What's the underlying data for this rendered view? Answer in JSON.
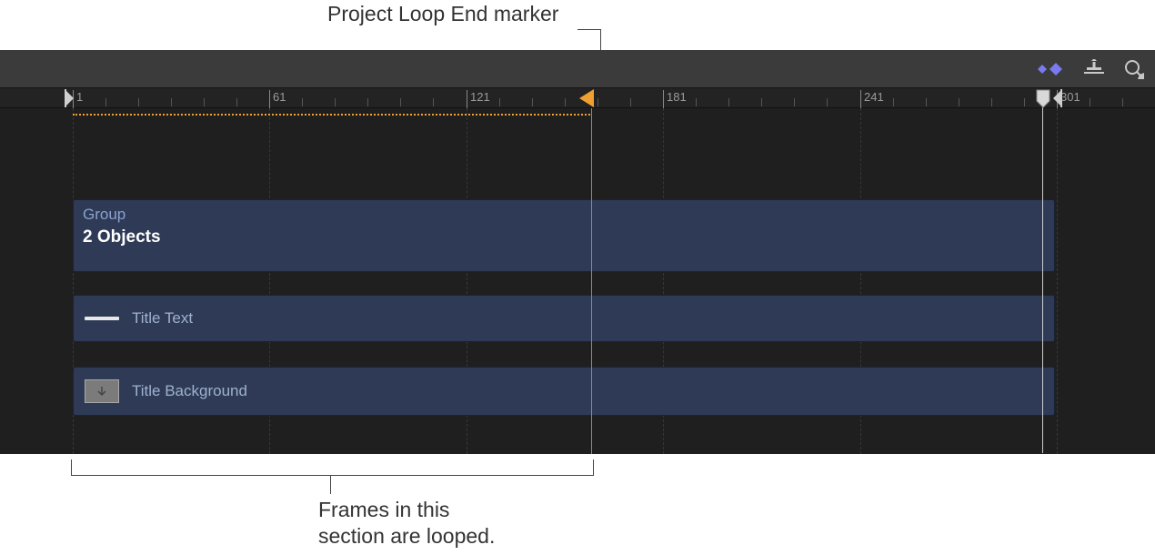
{
  "annotations": {
    "top": "Project Loop End marker",
    "bottom_line1": "Frames in this",
    "bottom_line2": "section are looped."
  },
  "ruler": {
    "labels": [
      "1",
      "61",
      "121",
      "181",
      "241",
      "301"
    ]
  },
  "tracks": {
    "group": {
      "label": "Group",
      "count": "2 Objects"
    },
    "items": [
      {
        "label": "Title Text"
      },
      {
        "label": "Title Background"
      }
    ]
  }
}
